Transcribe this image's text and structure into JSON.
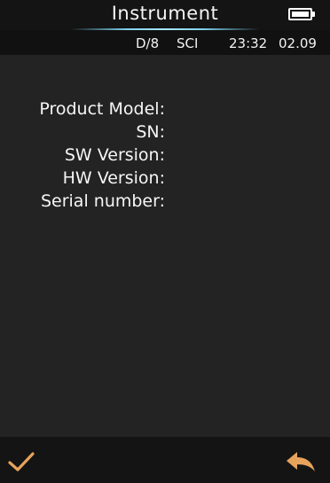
{
  "title": "Instrument",
  "status": {
    "geometry": "D/8",
    "mode": "SCI",
    "time": "23:32",
    "date": "02.09"
  },
  "info": {
    "product_model_label": "Product Model:",
    "sn_label": "SN:",
    "sw_version_label": "SW Version:",
    "hw_version_label": "HW Version:",
    "serial_number_label": "Serial number:"
  },
  "icons": {
    "battery": "battery-full-icon",
    "confirm": "check-icon",
    "back": "back-arrow-icon"
  },
  "colors": {
    "background": "#232323",
    "bar": "#141414",
    "accent": "#e7a35b",
    "title_underline": "#7ed3f0"
  }
}
